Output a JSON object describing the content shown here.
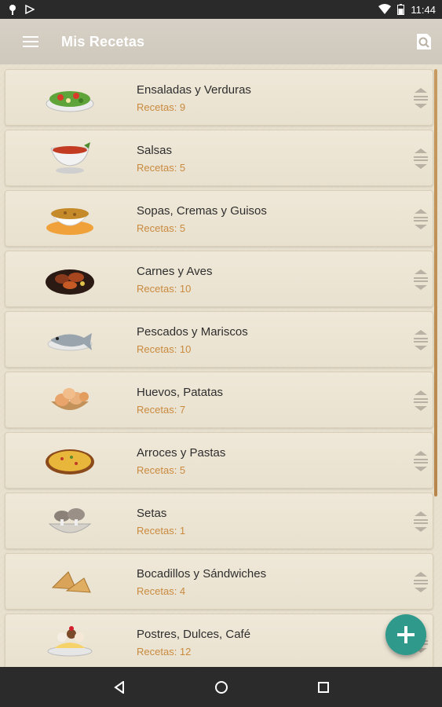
{
  "status_bar": {
    "time": "11:44"
  },
  "app_bar": {
    "title": "Mis Recetas"
  },
  "categories": [
    {
      "name": "Ensaladas y Verduras",
      "count": "Recetas: 9",
      "icon": "salad-icon"
    },
    {
      "name": "Salsas",
      "count": "Recetas: 5",
      "icon": "sauce-boat-icon"
    },
    {
      "name": "Sopas, Cremas y Guisos",
      "count": "Recetas: 5",
      "icon": "soup-bowl-icon"
    },
    {
      "name": "Carnes y Aves",
      "count": "Recetas: 10",
      "icon": "meat-dish-icon"
    },
    {
      "name": "Pescados y Mariscos",
      "count": "Recetas: 10",
      "icon": "fish-icon"
    },
    {
      "name": "Huevos, Patatas",
      "count": "Recetas: 7",
      "icon": "eggs-basket-icon"
    },
    {
      "name": "Arroces y Pastas",
      "count": "Recetas: 5",
      "icon": "paella-icon"
    },
    {
      "name": "Setas",
      "count": "Recetas: 1",
      "icon": "mushrooms-icon"
    },
    {
      "name": "Bocadillos y Sándwiches",
      "count": "Recetas: 4",
      "icon": "sandwich-icon"
    },
    {
      "name": "Postres, Dulces, Café",
      "count": "Recetas: 12",
      "icon": "dessert-icon"
    }
  ],
  "colors": {
    "accent": "#2f9a8c",
    "count_text": "#c98a3e",
    "status_bar": "#2a2a2a"
  }
}
